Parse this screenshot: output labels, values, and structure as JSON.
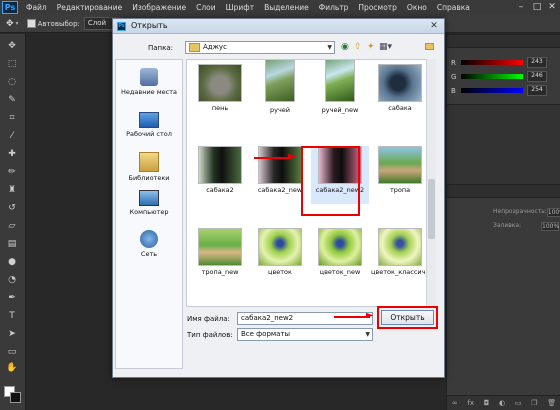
{
  "menubar": {
    "items": [
      "Файл",
      "Редактирование",
      "Изображение",
      "Слои",
      "Шрифт",
      "Выделение",
      "Фильтр",
      "Просмотр",
      "Окно",
      "Справка"
    ],
    "logo": "Ps"
  },
  "options": {
    "autoselect_label": "Автовыбор:",
    "autoselect_value": "Слой"
  },
  "right_panel": {
    "sliders": [
      {
        "label": "R",
        "value": "243",
        "gradient": "linear-gradient(90deg,#000,#f00)"
      },
      {
        "label": "G",
        "value": "246",
        "gradient": "linear-gradient(90deg,#000,#0f0)"
      },
      {
        "label": "B",
        "value": "254",
        "gradient": "linear-gradient(90deg,#000,#00f)"
      }
    ],
    "opacity_label": "Непрозрачность:",
    "opacity_value": "100%",
    "fill_label": "Заливка:",
    "fill_value": "100%"
  },
  "dialog": {
    "title": "Открыть",
    "folder_label": "Папка:",
    "folder_value": "Аджус",
    "filename_label": "Имя файла:",
    "filename_value": "сабака2_new2",
    "filetype_label": "Тип файлов:",
    "filetype_value": "Все форматы",
    "open_button": "Открыть",
    "places": [
      "Недавние места",
      "Рабочий стол",
      "Библиотеки",
      "Компьютер",
      "Сеть"
    ],
    "files": [
      {
        "name": "пень",
        "colors": "radial-gradient(circle at 50% 55%,#8a8a80 30%,#5b6a40 60%,#3c4f26)"
      },
      {
        "name": "ручей",
        "colors": "linear-gradient(160deg,#4d7a2c,#b9d7e2 45%,#7fa05c 60%,#3d5e22)"
      },
      {
        "name": "ручей_new",
        "colors": "linear-gradient(160deg,#3e7d2a,#c9e6ee 45%,#80b052 60%,#2f5a1c)"
      },
      {
        "name": "сабака",
        "colors": "radial-gradient(circle at 45% 50%,#1f2e3e 25%,#5a7590 50%,#9ab3c8)"
      },
      {
        "name": "сабака2",
        "colors": "linear-gradient(90deg,#cfd8c6,#223322 35%,#101010 55%,#4a6a40)"
      },
      {
        "name": "сабака2_new",
        "colors": "linear-gradient(90deg,#d6c6d0,#2a2a2a 35%,#0d0d0d 55%,#5a7a40)"
      },
      {
        "name": "сабака2_new2",
        "colors": "linear-gradient(90deg,#e8b6cc,#2a1a22 35%,#0d0d0d 55%,#d06a8a)"
      },
      {
        "name": "тропа",
        "colors": "linear-gradient(180deg,#8fc3e6,#6aa84f 45%,#c9a77a 65%,#3f7a2a)"
      },
      {
        "name": "тропа_new",
        "colors": "linear-gradient(180deg,#a8d06a,#6ab04a 45%,#d9b886 65%,#4f8a30)"
      },
      {
        "name": "цветок",
        "colors": "radial-gradient(circle at 50% 40%,#2c4aa0 10%,#9ccf4a 30%,#e6f2b0 60%,#7aa83a)"
      },
      {
        "name": "цветок_new",
        "colors": "radial-gradient(circle at 50% 40%,#2c4aa0 10%,#8fc83a 30%,#dff0a0 60%,#6a9a2a)"
      },
      {
        "name": "цветок_классич...",
        "colors": "radial-gradient(circle at 50% 40%,#34509e 10%,#a2d050 30%,#f0f6c0 60%,#86ac44)"
      }
    ]
  }
}
